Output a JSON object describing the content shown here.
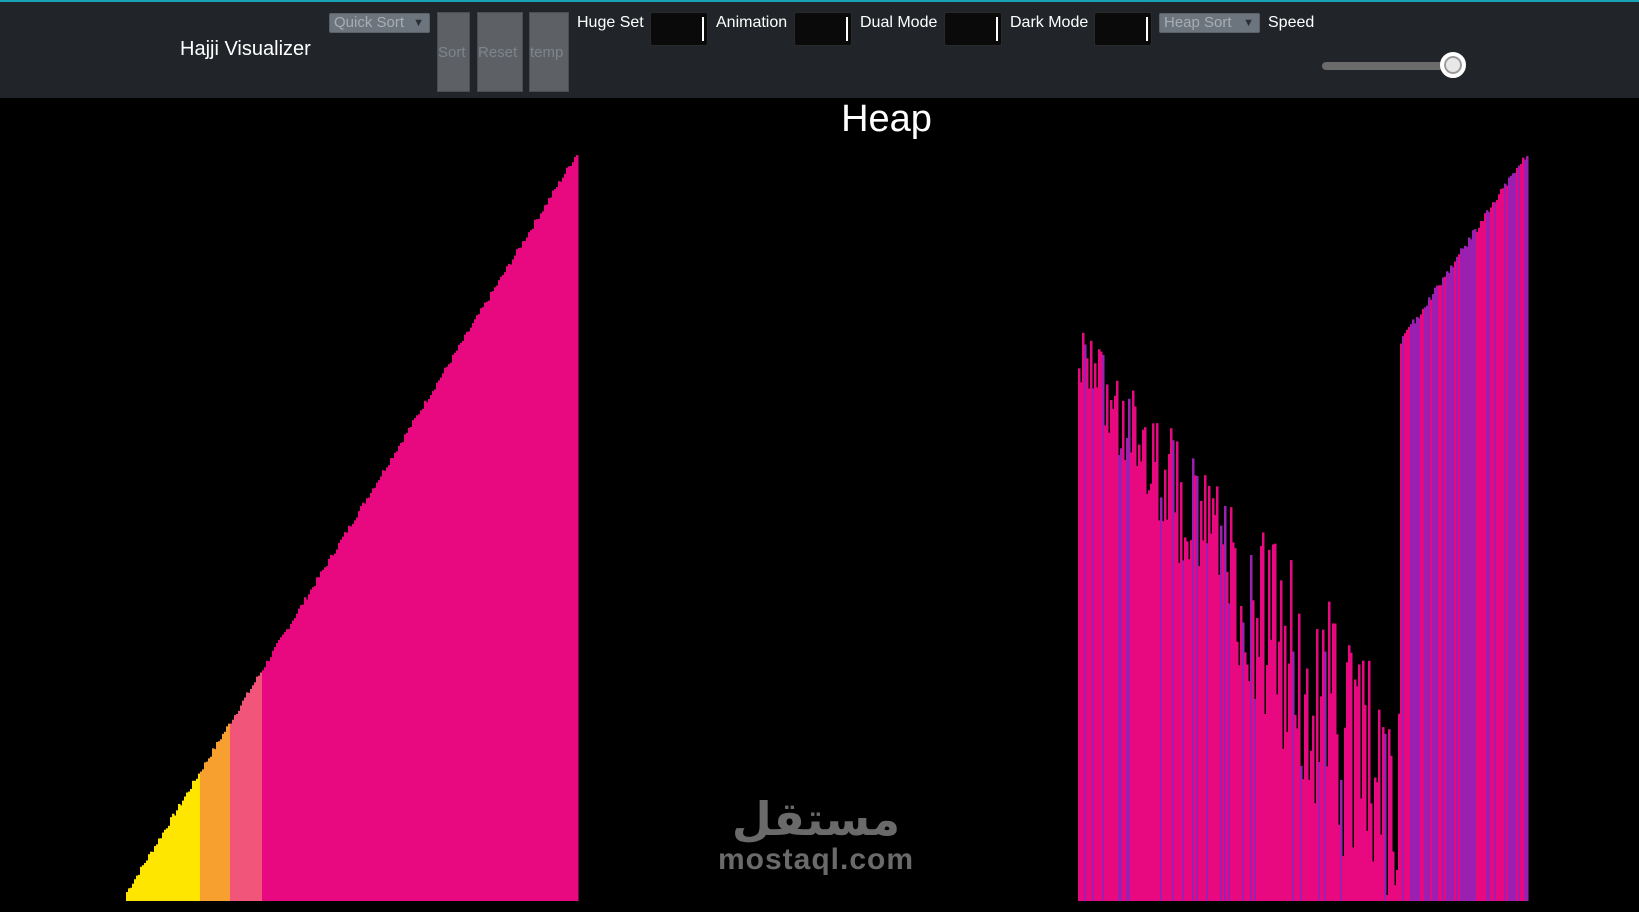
{
  "navbar": {
    "brand": "Hajji Visualizer",
    "algorithm_select": "Quick Sort",
    "buttons": {
      "sort": "Sort",
      "reset": "Reset",
      "temp": "temp"
    },
    "toggles": {
      "huge_set": "Huge Set",
      "animation": "Animation",
      "dual_mode": "Dual Mode",
      "dark_mode": "Dark Mode"
    },
    "second_algorithm_select": "Heap Sort",
    "speed_label": "Speed",
    "speed_value": 0.95
  },
  "main": {
    "title": "Heap"
  },
  "watermark": {
    "arabic": "مستقل",
    "latin": "mostaql.com"
  },
  "colors": {
    "navbar_bg": "#212529",
    "accent_line": "#17a2b8",
    "bar_default": "#e8087f",
    "bar_low": "#ffe600",
    "bar_mid": "#f7a030",
    "bar_compare": "#9b1fb0",
    "background": "#000000"
  }
}
